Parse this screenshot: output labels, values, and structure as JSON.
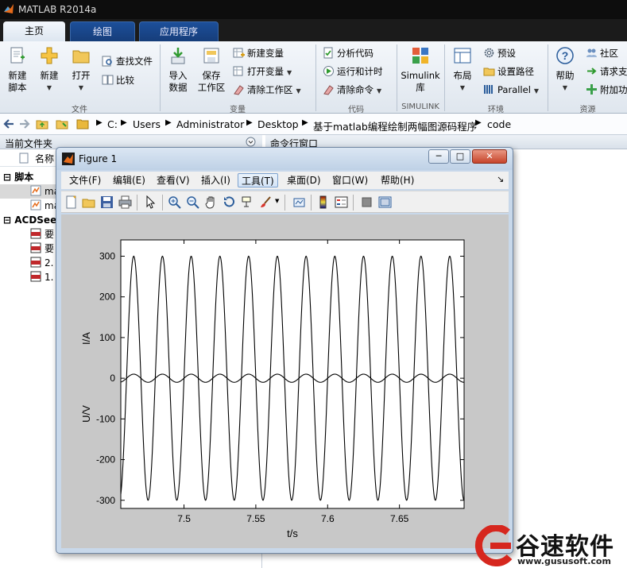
{
  "app": {
    "title": "MATLAB R2014a"
  },
  "tabs": [
    {
      "label": "主页",
      "active": true
    },
    {
      "label": "绘图",
      "active": false
    },
    {
      "label": "应用程序",
      "active": false
    }
  ],
  "ribbon": {
    "file_group": {
      "label": "文件",
      "new_script": "新建\n脚本",
      "new": "新建",
      "open": "打开",
      "find_files": "查找文件",
      "compare": "比较"
    },
    "variable_group": {
      "label": "变量",
      "import_data": "导入\n数据",
      "save_workspace": "保存\n工作区",
      "new_variable": "新建变量",
      "open_variable": "打开变量",
      "clear_workspace": "清除工作区"
    },
    "code_group": {
      "label": "代码",
      "analyze_code": "分析代码",
      "run_and_time": "运行和计时",
      "clear_commands": "清除命令"
    },
    "simulink_group": {
      "label": "SIMULINK",
      "simulink_library": "Simulink\n库"
    },
    "environment_group": {
      "label": "环境",
      "layout": "布局",
      "preferences": "预设",
      "set_path": "设置路径",
      "parallel": "Parallel"
    },
    "resources_group": {
      "label": "资源",
      "help": "帮助",
      "community": "社区",
      "request_support": "请求支",
      "add_ons": "附加功"
    }
  },
  "address_bar": {
    "path": [
      "C:",
      "Users",
      "Administrator",
      "Desktop",
      "基于matlab编程绘制两幅图源码程序",
      "code"
    ]
  },
  "current_folder": {
    "title": "当前文件夹",
    "column_name": "名称",
    "groups": [
      {
        "label": "脚本",
        "items": [
          "ma",
          "ma"
        ]
      },
      {
        "label": "ACDSee",
        "items": [
          "要",
          "要",
          "2.",
          "1."
        ]
      }
    ]
  },
  "command_window": {
    "title": "命令行窗口"
  },
  "figure": {
    "title": "Figure 1",
    "window_buttons": {
      "minimize": "─",
      "maximize": "□",
      "close": "✕"
    },
    "menu": [
      "文件(F)",
      "编辑(E)",
      "查看(V)",
      "插入(I)",
      "工具(T)",
      "桌面(D)",
      "窗口(W)",
      "帮助(H)"
    ],
    "toolbar_icons": [
      "new-figure-icon",
      "open-file-icon",
      "save-icon",
      "print-icon",
      "select-arrow-icon",
      "zoom-in-icon",
      "zoom-out-icon",
      "pan-hand-icon",
      "rotate-3d-icon",
      "data-cursor-icon",
      "brush-icon",
      "link-plot-icon",
      "colorbar-icon",
      "legend-icon",
      "hide-plot-tools-icon",
      "show-plot-tools-icon"
    ]
  },
  "chart_data": {
    "type": "line",
    "title": "",
    "xlabel": "t/s",
    "ylabel_upper": "I/A",
    "ylabel_lower": "U/V",
    "xlim": [
      7.456,
      7.695
    ],
    "ylim": [
      -320,
      340
    ],
    "xticks": [
      7.5,
      7.55,
      7.6,
      7.65
    ],
    "xtick_labels": [
      "7.5",
      "7.55",
      "7.6",
      "7.65"
    ],
    "yticks": [
      300,
      200,
      100,
      0,
      -100,
      -200,
      -300
    ],
    "ytick_labels": [
      "300",
      "200",
      "100",
      "0",
      "-100",
      "-200",
      "-300"
    ],
    "grid": false,
    "series": [
      {
        "amplitude": 300,
        "frequency_hz": 50,
        "phase_deg": 0
      },
      {
        "amplitude": 10,
        "frequency_hz": 50,
        "phase_deg": 0
      }
    ]
  },
  "watermark": {
    "name": "谷速软件",
    "url": "www.gususoft.com"
  },
  "colors": {
    "matlab_orange": "#e56a1a",
    "watermark_red": "#d6271e",
    "tab_blue": "#1c4f9a"
  }
}
